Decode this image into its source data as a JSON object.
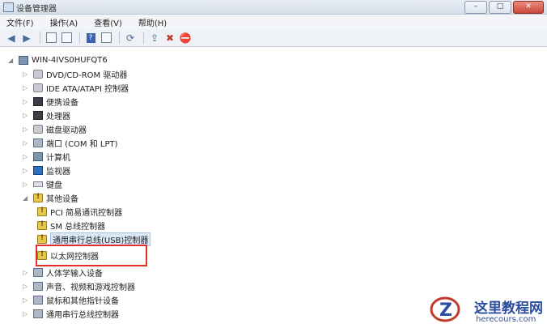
{
  "window": {
    "title": "设备管理器",
    "min": "–",
    "max": "□",
    "close": "✕"
  },
  "menu": [
    "文件(F)",
    "操作(A)",
    "查看(V)",
    "帮助(H)"
  ],
  "toolbar": {
    "back": "back-arrow",
    "forward": "forward-arrow"
  },
  "tree": {
    "root": "WIN-4IVS0HUFQT6",
    "items": [
      "DVD/CD-ROM 驱动器",
      "IDE ATA/ATAPI 控制器",
      "便携设备",
      "处理器",
      "磁盘驱动器",
      "端口 (COM 和 LPT)",
      "计算机",
      "监视器",
      "键盘",
      "其他设备",
      "PCI 简易通讯控制器",
      "SM 总线控制器",
      "通用串行总线(USB)控制器",
      "以太网控制器",
      "人体学输入设备",
      "声音、视频和游戏控制器",
      "鼠标和其他指针设备",
      "通用串行总线控制器"
    ]
  },
  "watermark": {
    "title": "这里教程网",
    "url": "herecours.com"
  },
  "colors": {
    "highlight": "#e0302c",
    "accent": "#2b4ea0"
  }
}
